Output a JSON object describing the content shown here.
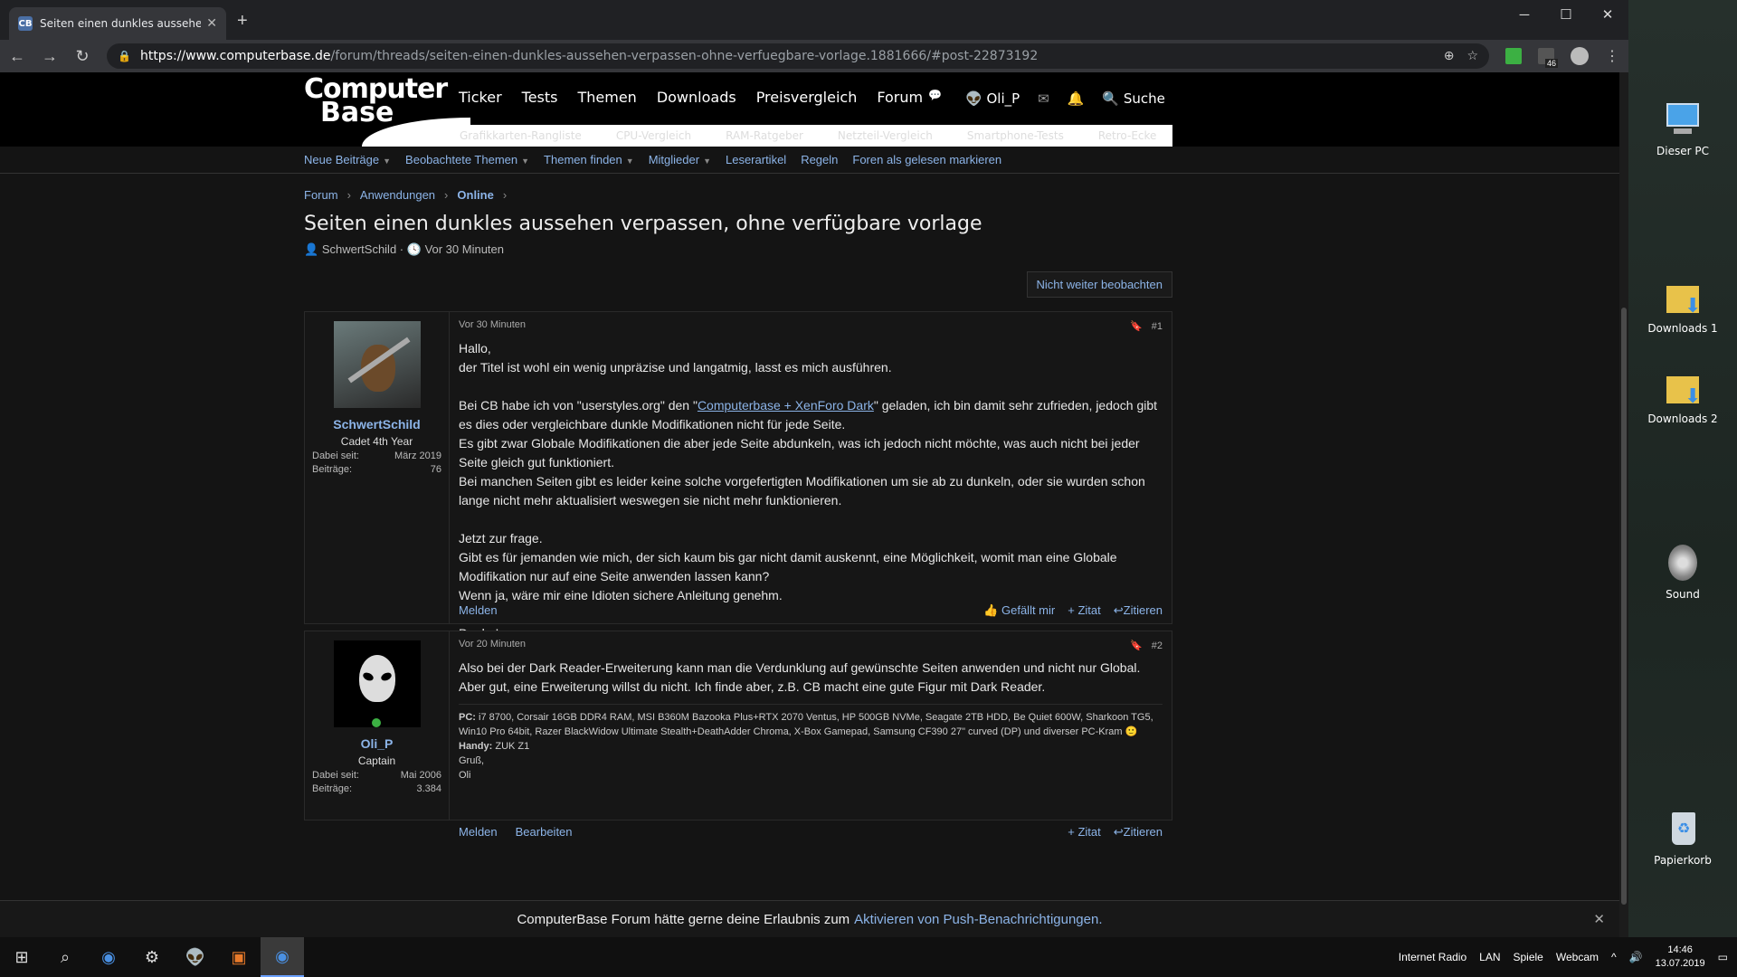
{
  "browser": {
    "tab_title": "Seiten einen dunkles aussehen ve",
    "favicon": "CB",
    "url_host": "https://www.computerbase.de",
    "url_path": "/forum/threads/seiten-einen-dunkles-aussehen-verpassen-ohne-verfuegbare-vorlage.1881666/#post-22873192",
    "ext_badge": "46"
  },
  "site": {
    "logo_line1": "Computer",
    "logo_line2": "Base",
    "nav": [
      "Ticker",
      "Tests",
      "Themen",
      "Downloads",
      "Preisvergleich",
      "Forum"
    ],
    "user": "Oli_P",
    "search": "Suche",
    "sub_links": [
      "Grafikkarten-Rangliste",
      "CPU-Vergleich",
      "RAM-Ratgeber",
      "Netzteil-Vergleich",
      "Smartphone-Tests",
      "Retro-Ecke"
    ],
    "secondary": [
      "Neue Beiträge",
      "Beobachtete Themen",
      "Themen finden",
      "Mitglieder",
      "Leserartikel",
      "Regeln",
      "Foren als gelesen markieren"
    ]
  },
  "thread": {
    "breadcrumb": [
      "Forum",
      "Anwendungen",
      "Online"
    ],
    "title": "Seiten einen dunkles aussehen verpassen, ohne verfügbare vorlage",
    "author": "SchwertSchild",
    "time": "Vor 30 Minuten",
    "watch_button": "Nicht weiter beobachten"
  },
  "posts": [
    {
      "user": "SchwertSchild",
      "rank": "Cadet 4th Year",
      "joined_label": "Dabei seit:",
      "joined": "März 2019",
      "posts_label": "Beiträge:",
      "count": "76",
      "time": "Vor 30 Minuten",
      "num": "#1",
      "p1": "Hallo,",
      "p2": "der Titel ist wohl ein wenig unpräzise und langatmig, lasst es mich ausführen.",
      "p3a": "Bei CB habe ich von \"userstyles.org\" den \"",
      "p3link": "Computerbase + XenForo Dark",
      "p3b": "\" geladen, ich bin damit sehr zufrieden, jedoch gibt es dies oder vergleichbare dunkle Modifikationen nicht für jede Seite.",
      "p4": "Es gibt zwar Globale Modifikationen die aber jede Seite abdunkeln, was ich jedoch nicht möchte, was auch nicht bei jeder Seite gleich gut funktioniert.",
      "p5": "Bei manchen Seiten gibt es leider keine solche vorgefertigten Modifikationen um sie ab zu dunkeln, oder sie wurden schon lange nicht mehr aktualisiert weswegen sie nicht mehr funktionieren.",
      "p6": "Jetzt zur frage.",
      "p7": "Gibt es für jemanden wie mich, der sich kaum bis gar nicht damit auskennt, eine Möglichkeit, womit man eine Globale Modifikation nur auf eine Seite anwenden lassen kann?",
      "p8": "Wenn ja, wäre mir eine Idioten sichere Anleitung genehm.",
      "p9": "Danke!",
      "report": "Melden",
      "like": "Gefällt mir",
      "quote": "+ Zitat",
      "reply": "Zitieren"
    },
    {
      "user": "Oli_P",
      "rank": "Captain",
      "joined_label": "Dabei seit:",
      "joined": "Mai 2006",
      "posts_label": "Beiträge:",
      "count": "3.384",
      "time": "Vor 20 Minuten",
      "num": "#2",
      "p1": "Also bei der Dark Reader-Erweiterung kann man die Verdunklung auf gewünschte Seiten anwenden und nicht nur Global. Aber gut, eine Erweiterung willst du nicht. Ich finde aber, z.B. CB macht eine gute Figur mit Dark Reader.",
      "sig_pc_label": "PC:",
      "sig_pc": "i7 8700, Corsair 16GB DDR4 RAM, MSI B360M Bazooka Plus+RTX 2070 Ventus, HP 500GB NVMe, Seagate 2TB HDD, Be Quiet 600W, Sharkoon TG5, Win10 Pro 64bit, Razer BlackWidow Ultimate Stealth+DeathAdder Chroma, X-Box Gamepad, Samsung CF390 27\" curved (DP) und diverser PC-Kram",
      "sig_handy_label": "Handy:",
      "sig_handy": "ZUK Z1",
      "sig_greet": "Gruß,",
      "sig_name": "Oli",
      "report": "Melden",
      "edit": "Bearbeiten",
      "quote": "+ Zitat",
      "reply": "Zitieren"
    }
  ],
  "notification": {
    "text": "ComputerBase Forum hätte gerne deine Erlaubnis zum",
    "link": "Aktivieren von Push-Benachrichtigungen."
  },
  "desktop": [
    "Dieser PC",
    "Downloads 1",
    "Downloads 2",
    "Sound",
    "Papierkorb"
  ],
  "taskbar": {
    "tray": [
      "Internet Radio",
      "LAN",
      "Spiele",
      "Webcam"
    ],
    "time": "14:46",
    "date": "13.07.2019"
  }
}
